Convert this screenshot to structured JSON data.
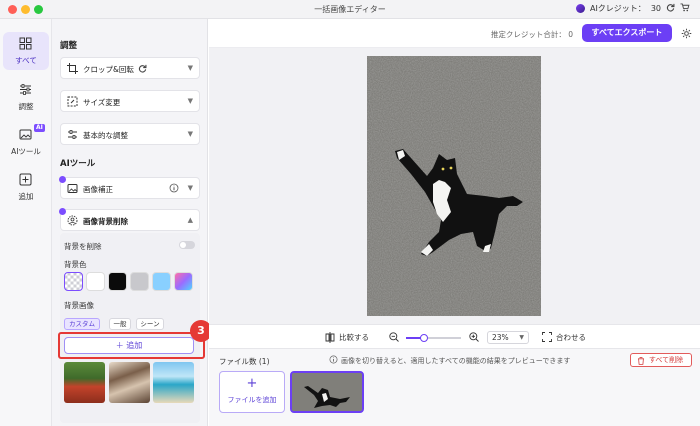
{
  "window": {
    "title": "一括画像エディター"
  },
  "header": {
    "ai_credit_label": "AIクレジット：",
    "ai_credit_value": "30",
    "estimated_label": "推定クレジット合計：",
    "estimated_value": "0",
    "export_all": "すべてエクスポート"
  },
  "rail": {
    "items": [
      {
        "label": "すべて"
      },
      {
        "label": "調整"
      },
      {
        "label": "AIツール"
      },
      {
        "label": "追加"
      }
    ],
    "ai_badge": "AI"
  },
  "panel": {
    "adjust_title": "調整",
    "adjust_items": [
      {
        "label": "クロップ&回転"
      },
      {
        "label": "サイズ変更"
      },
      {
        "label": "基本的な調整"
      }
    ],
    "ai_title": "AIツール",
    "ai_items": [
      {
        "label": "画像補正"
      },
      {
        "label": "画像背景削除"
      }
    ],
    "remove_bg_label": "背景を削除",
    "bg_color_label": "背景色",
    "bg_image_label": "背景画像",
    "bg_tabs": [
      "カスタム",
      "一般",
      "シーン"
    ],
    "add_label": "＋ 追加",
    "step_number": "3"
  },
  "toolbar": {
    "compare": "比較する",
    "zoom": "23%",
    "fit": "合わせる"
  },
  "files": {
    "count_label": "ファイル数 (1)",
    "hint": "画像を切り替えると、適用したすべての機能の結果をプレビューできます",
    "delete_all": "すべて削除",
    "add_file": "ファイルを追加"
  },
  "colors": {
    "accent": "#6c3ff5",
    "highlight": "#e53935"
  }
}
